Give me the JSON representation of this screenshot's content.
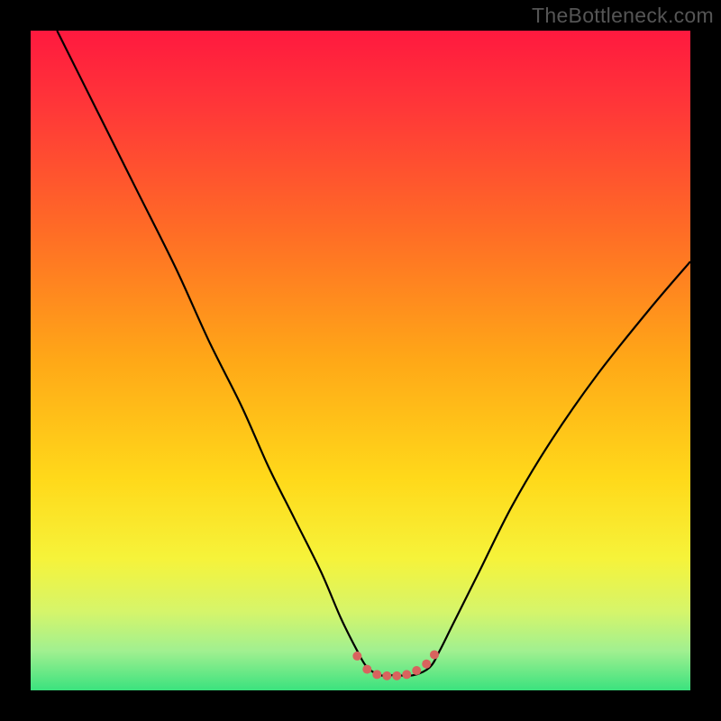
{
  "watermark": "TheBottleneck.com",
  "chart_data": {
    "type": "line",
    "title": "",
    "xlabel": "",
    "ylabel": "",
    "xlim": [
      0,
      100
    ],
    "ylim": [
      0,
      100
    ],
    "grid": false,
    "legend": false,
    "background_gradient": {
      "stops": [
        {
          "offset": 0.0,
          "color": "#ff193f"
        },
        {
          "offset": 0.12,
          "color": "#ff3838"
        },
        {
          "offset": 0.3,
          "color": "#ff6b26"
        },
        {
          "offset": 0.5,
          "color": "#ffa817"
        },
        {
          "offset": 0.68,
          "color": "#ffd91a"
        },
        {
          "offset": 0.8,
          "color": "#f6f33a"
        },
        {
          "offset": 0.88,
          "color": "#d6f56a"
        },
        {
          "offset": 0.94,
          "color": "#a1f090"
        },
        {
          "offset": 1.0,
          "color": "#3be27e"
        }
      ]
    },
    "series": [
      {
        "name": "bottleneck-curve",
        "color": "#000000",
        "x": [
          4,
          10,
          16,
          22,
          27,
          32,
          36,
          40,
          44,
          47,
          49.5,
          51,
          53,
          55,
          58,
          60.5,
          62,
          64,
          68,
          73,
          79,
          86,
          94,
          100
        ],
        "y": [
          100,
          88,
          76,
          64,
          53,
          43,
          34,
          26,
          18,
          11,
          6,
          3.5,
          2.3,
          2.3,
          2.3,
          3.5,
          6,
          10,
          18,
          28,
          38,
          48,
          58,
          65
        ]
      }
    ],
    "markers": {
      "name": "valley-highlight",
      "color": "#d8635e",
      "x": [
        49.5,
        51,
        52.5,
        54,
        55.5,
        57,
        58.5,
        60,
        61.2
      ],
      "y": [
        5.2,
        3.2,
        2.4,
        2.2,
        2.2,
        2.4,
        3.0,
        4.0,
        5.4
      ],
      "radius": 5
    }
  }
}
